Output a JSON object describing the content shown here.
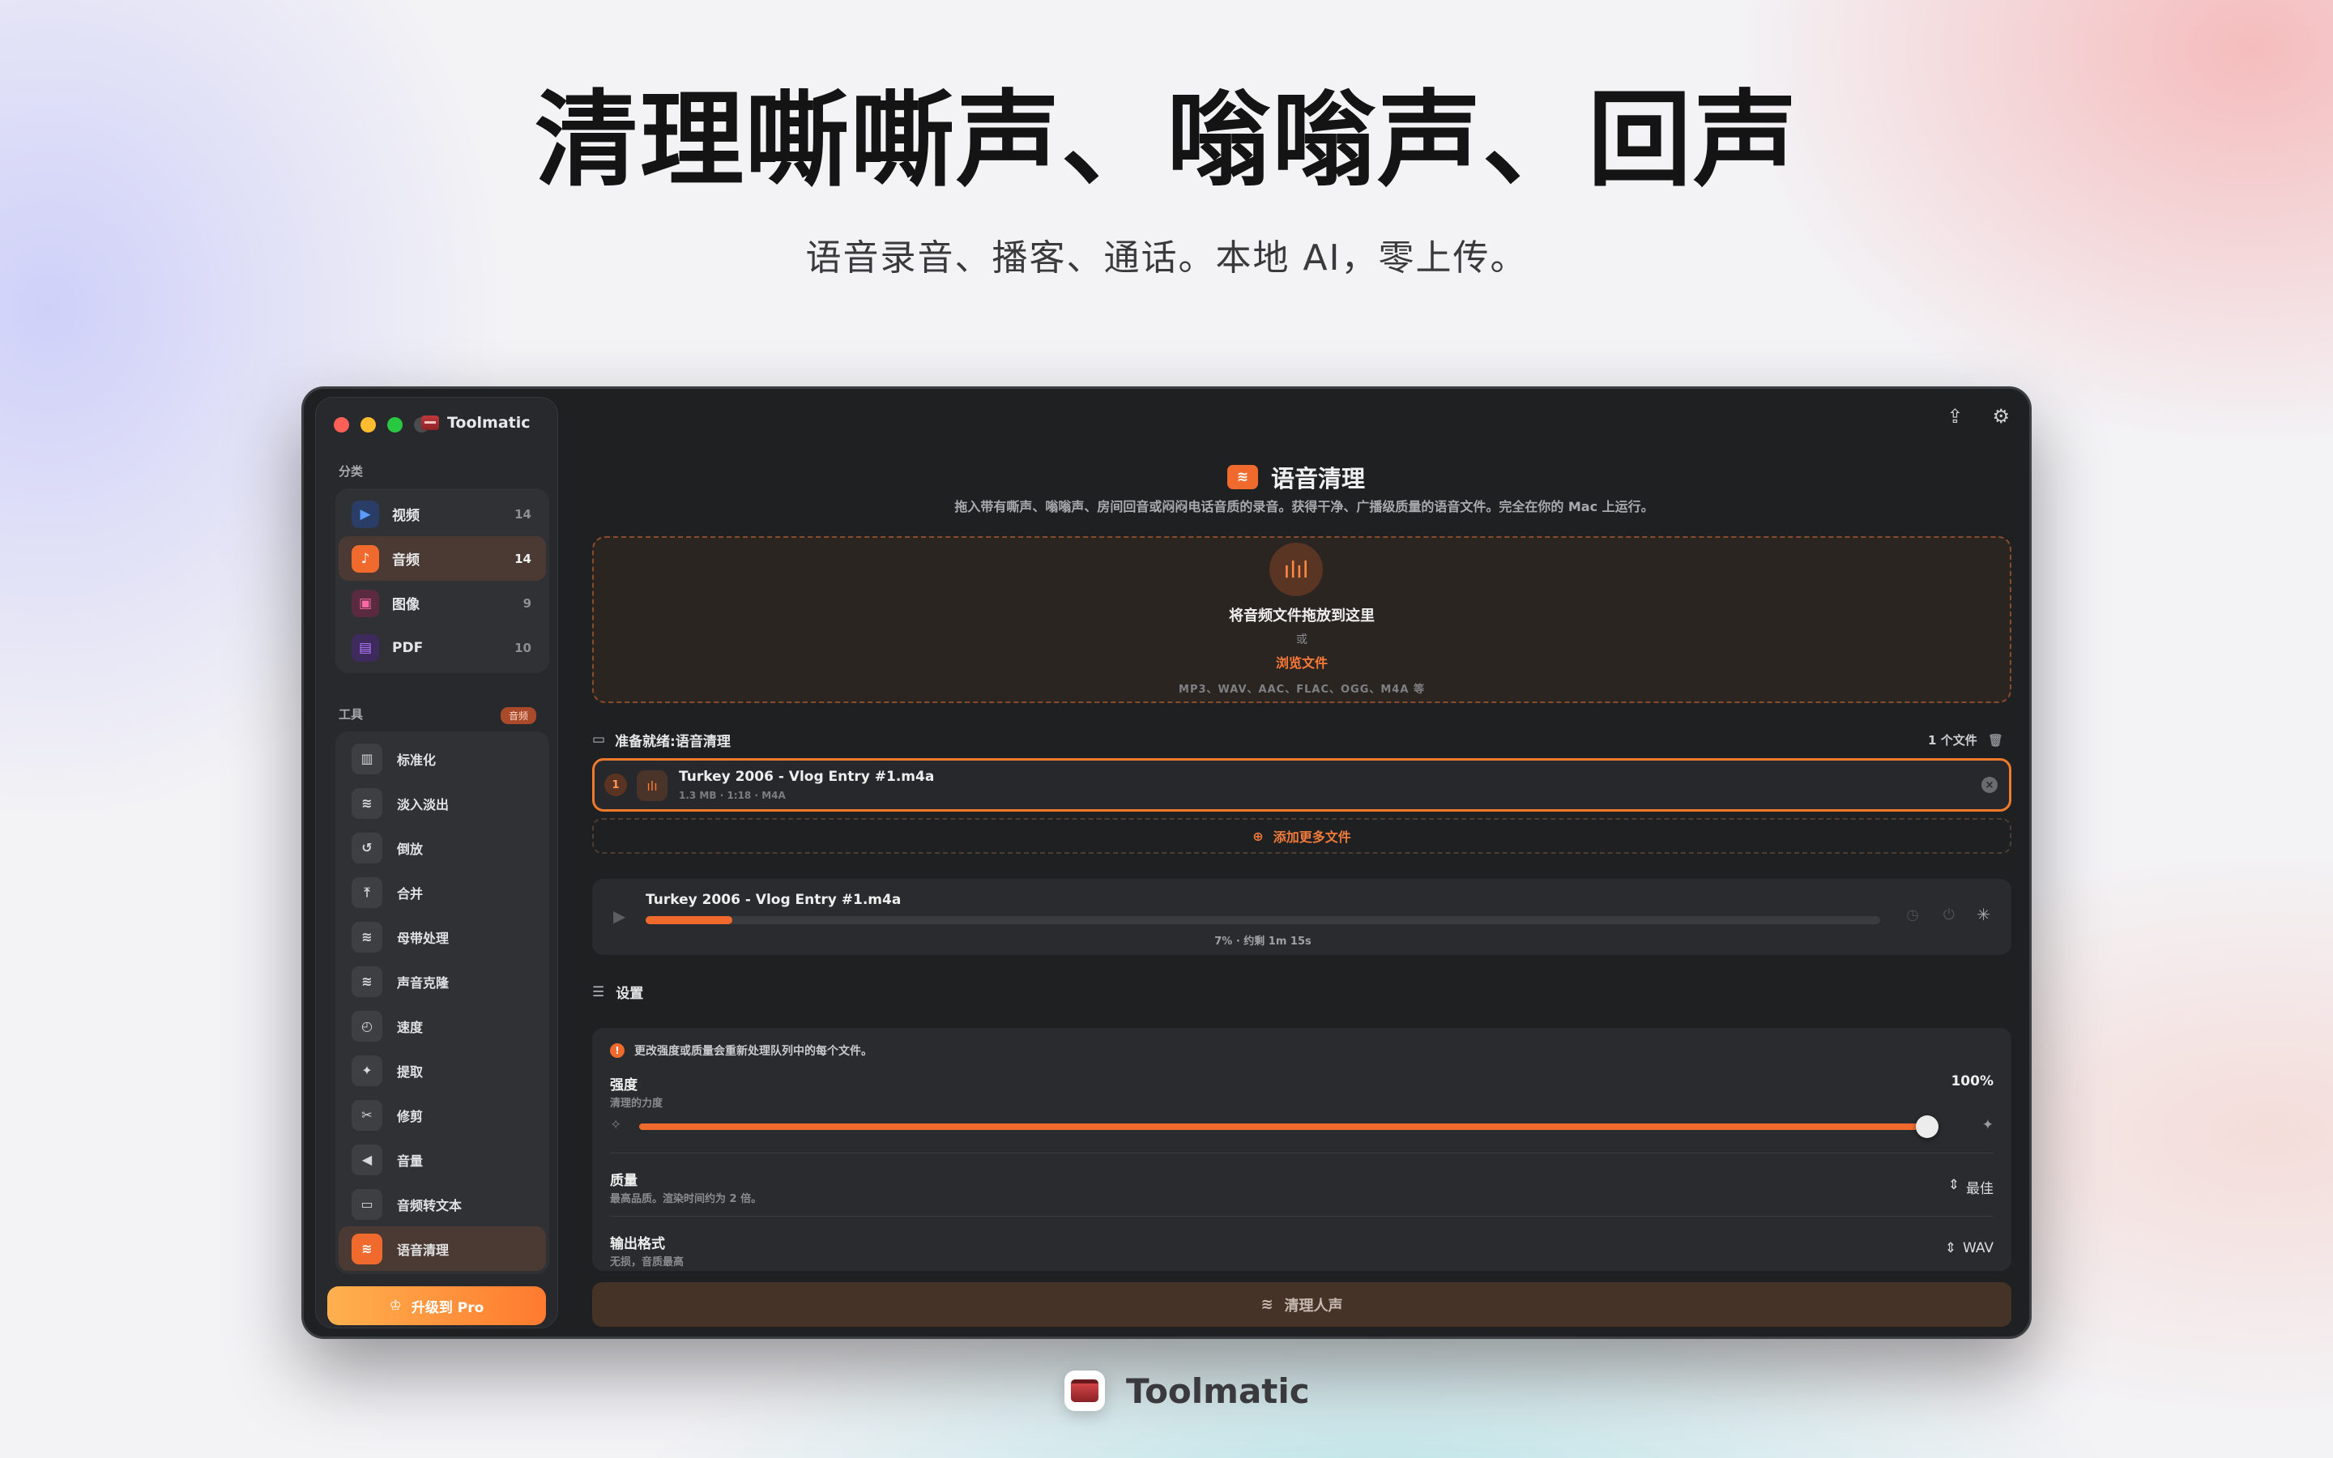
{
  "hero": {
    "title": "清理嘶嘶声、嗡嗡声、回声",
    "subtitle": "语音录音、播客、通话。本地 AI，零上传。"
  },
  "app": {
    "name": "Toolmatic"
  },
  "sidebar": {
    "categories_label": "分类",
    "categories": [
      {
        "label": "视频",
        "count": "14",
        "icon": "video-icon",
        "color": "#2f6fe4"
      },
      {
        "label": "音频",
        "count": "14",
        "icon": "music-note-icon",
        "color": "#ef6a2c",
        "active": true
      },
      {
        "label": "图像",
        "count": "9",
        "icon": "image-icon",
        "color": "#d63c78"
      },
      {
        "label": "PDF",
        "count": "10",
        "icon": "document-icon",
        "color": "#8a3fd6"
      }
    ],
    "tools_label": "工具",
    "tools_badge": "音频",
    "tools": [
      {
        "label": "标准化",
        "icon": "normalize-icon"
      },
      {
        "label": "淡入淡出",
        "icon": "fade-icon"
      },
      {
        "label": "倒放",
        "icon": "reverse-icon"
      },
      {
        "label": "合并",
        "icon": "merge-icon"
      },
      {
        "label": "母带处理",
        "icon": "mastering-icon"
      },
      {
        "label": "声音克隆",
        "icon": "voice-clone-icon"
      },
      {
        "label": "速度",
        "icon": "speed-icon"
      },
      {
        "label": "提取",
        "icon": "extract-icon"
      },
      {
        "label": "修剪",
        "icon": "scissors-icon"
      },
      {
        "label": "音量",
        "icon": "speaker-icon"
      },
      {
        "label": "音频转文本",
        "icon": "transcribe-icon"
      },
      {
        "label": "语音清理",
        "icon": "voice-clean-icon",
        "active": true
      }
    ],
    "upgrade_label": "升级到 Pro"
  },
  "main": {
    "title": "语音清理",
    "description": "拖入带有嘶声、嗡嗡声、房间回音或闷闷电话音质的录音。获得干净、广播级质量的语音文件。完全在你的 Mac 上运行。",
    "dropzone": {
      "primary": "将音频文件拖放到这里",
      "or": "或",
      "browse": "浏览文件",
      "formats": "MP3、WAV、AAC、FLAC、OGG、M4A 等"
    },
    "queue": {
      "title": "准备就绪:语音清理",
      "count": "1 个文件",
      "add_more": "添加更多文件"
    },
    "file": {
      "index": "1",
      "name": "Turkey 2006 - Vlog Entry #1.m4a",
      "meta": "1.3 MB · 1:18 · M4A"
    },
    "player": {
      "name": "Turkey 2006 - Vlog Entry #1.m4a",
      "progress": 0.07,
      "status": "7% · 约剩 1m 15s"
    },
    "settings": {
      "title": "设置",
      "notice": "更改强度或质量会重新处理队列中的每个文件。",
      "strength_label": "强度",
      "strength_desc": "清理的力度",
      "strength_value": "100%",
      "strength": 1.0,
      "quality_label": "质量",
      "quality_desc": "最高品质。渲染时间约为 2 倍。",
      "quality_value": "最佳",
      "format_label": "输出格式",
      "format_desc": "无损，音质最高",
      "format_value": "WAV"
    },
    "cta": "清理人声"
  },
  "colors": {
    "accent": "#ef6a2c",
    "window_bg": "#1f2022",
    "sidebar_bg": "#28292c"
  }
}
